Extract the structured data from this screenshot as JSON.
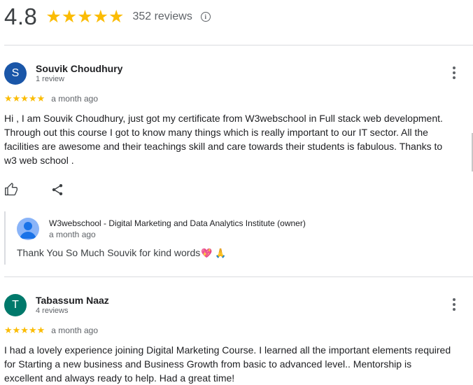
{
  "summary": {
    "rating": "4.8",
    "stars": "★★★★★",
    "count": "352 reviews",
    "info_glyph": "i"
  },
  "reviews": [
    {
      "initial": "S",
      "avatar_color": "#1a56a8",
      "name": "Souvik Choudhury",
      "meta": "1 review",
      "stars": "★★★★★",
      "date": "a month ago",
      "text": "Hi , I am Souvik Choudhury, just got my certificate from W3webschool in Full stack web development. Through out this course I got to know many things which is really important to our IT sector. All the facilities are awesome and their teachings skill and care towards their students is fabulous. Thanks to w3 web school .",
      "owner_reply": {
        "owner": "W3webschool - Digital Marketing and Data Analytics Institute (owner)",
        "date": "a month ago",
        "text": "Thank You So Much Souvik for kind words",
        "emojis": "💖 🙏"
      }
    },
    {
      "initial": "T",
      "avatar_color": "#00796b",
      "name": "Tabassum Naaz",
      "meta": "4 reviews",
      "stars": "★★★★★",
      "date": "a month ago",
      "text": "I had a lovely experience joining Digital Marketing Course. I learned all the important elements required for Starting a new business and Business Growth from basic to advanced level.. Mentorship is excellent and always ready to help. Had a great time!"
    }
  ],
  "colors": {
    "star": "#fbbc04",
    "divider": "#dadce0",
    "muted": "#5f6368"
  },
  "icons": [
    "info-icon",
    "more-vert-icon",
    "thumb-up-icon",
    "share-icon",
    "default-user-icon"
  ]
}
